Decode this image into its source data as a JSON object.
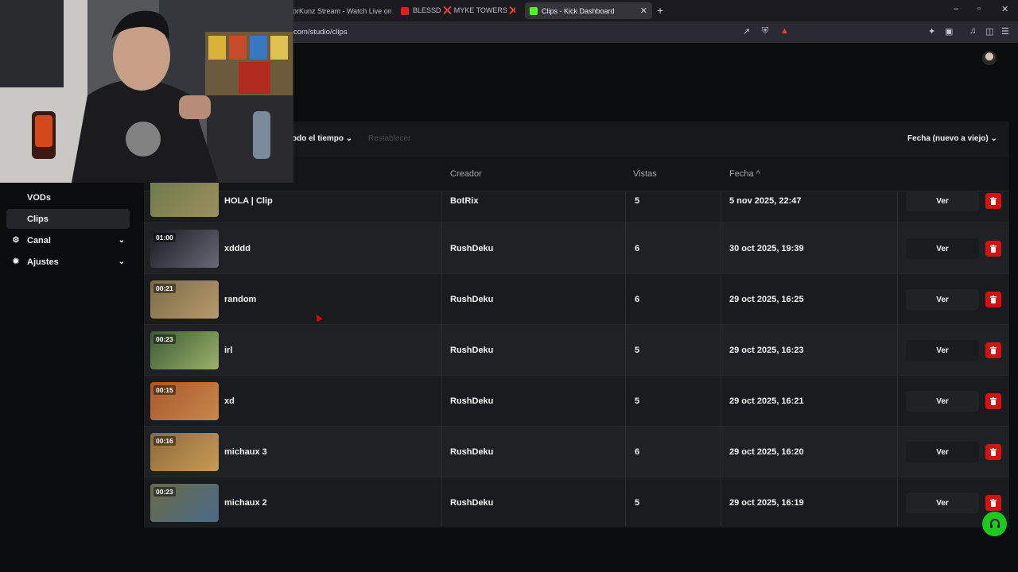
{
  "browser": {
    "tabs": [
      {
        "label": "orKunz Stream - Watch Live on K",
        "active": false,
        "color": "#2a2a2e"
      },
      {
        "label": "BLESSD ❌ MYKE TOWERS ❌ CH",
        "active": false,
        "color": "#e02020"
      },
      {
        "label": "Clips - Kick Dashboard",
        "active": true,
        "color": "#53fc18"
      }
    ],
    "close_tab": "✕",
    "new_tab": "+",
    "url": "com/studio/clips"
  },
  "sidebar": {
    "items": [
      {
        "label": "VODs",
        "active": false,
        "expandable": false,
        "icon": ""
      },
      {
        "label": "Clips",
        "active": true,
        "expandable": false,
        "icon": ""
      },
      {
        "label": "Canal",
        "active": false,
        "expandable": true,
        "icon": "channel-icon"
      },
      {
        "label": "Ajustes",
        "active": false,
        "expandable": true,
        "icon": "gear-icon"
      }
    ]
  },
  "filters": {
    "range_label": "odo el tiempo",
    "reset_label": "Restablecer",
    "sort_label": "Fecha (nuevo a viejo)"
  },
  "table": {
    "headers": {
      "creator": "Creador",
      "views": "Vistas",
      "date": "Fecha"
    },
    "sort_arrow": "^",
    "view_button": "Ver",
    "rows": [
      {
        "duration": "",
        "title": "HOLA | Clip",
        "creator": "BotRix",
        "views": "5",
        "date": "5 nov 2025, 22:47",
        "thumb": [
          "#6f7a4a",
          "#9c8f5e"
        ]
      },
      {
        "duration": "01:00",
        "title": "xdddd",
        "creator": "RushDeku",
        "views": "6",
        "date": "30 oct 2025, 19:39",
        "thumb": [
          "#1a1a22",
          "#6a6a78"
        ]
      },
      {
        "duration": "00:21",
        "title": "random",
        "creator": "RushDeku",
        "views": "6",
        "date": "29 oct 2025, 16:25",
        "thumb": [
          "#7d6b48",
          "#b59a6a"
        ]
      },
      {
        "duration": "00:23",
        "title": "irl",
        "creator": "RushDeku",
        "views": "5",
        "date": "29 oct 2025, 16:23",
        "thumb": [
          "#3d5a36",
          "#9bb26a"
        ]
      },
      {
        "duration": "00:15",
        "title": "xd",
        "creator": "RushDeku",
        "views": "5",
        "date": "29 oct 2025, 16:21",
        "thumb": [
          "#a8592e",
          "#c9874a"
        ]
      },
      {
        "duration": "00:16",
        "title": "michaux 3",
        "creator": "RushDeku",
        "views": "6",
        "date": "29 oct 2025, 16:20",
        "thumb": [
          "#8d6a3a",
          "#c79a55"
        ]
      },
      {
        "duration": "00:23",
        "title": "michaux 2",
        "creator": "RushDeku",
        "views": "5",
        "date": "29 oct 2025, 16:19",
        "thumb": [
          "#6a6a48",
          "#4a6a8a"
        ]
      }
    ]
  },
  "colors": {
    "accent": "#53fc18",
    "danger": "#d01414"
  }
}
